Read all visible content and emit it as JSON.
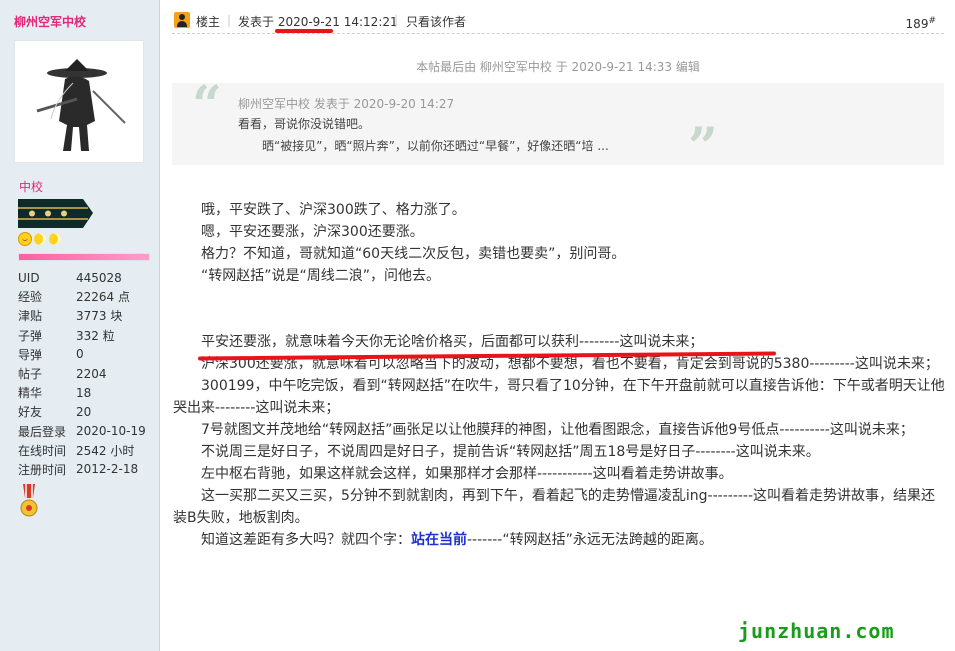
{
  "sidebar": {
    "username": "柳州空军中校",
    "rank": "中校",
    "progress": 1.0,
    "stats": [
      {
        "label": "UID",
        "value": "445028"
      },
      {
        "label": "经验",
        "value": "22264 点"
      },
      {
        "label": "津贴",
        "value": "3773 块"
      },
      {
        "label": "子弹",
        "value": "332 粒"
      },
      {
        "label": "导弹",
        "value": "0"
      },
      {
        "label": "帖子",
        "value": "2204"
      },
      {
        "label": "精华",
        "value": "18"
      },
      {
        "label": "好友",
        "value": "20"
      },
      {
        "label": "最后登录",
        "value": "2020-10-19"
      },
      {
        "label": "在线时间",
        "value": "2542 小时"
      },
      {
        "label": "注册时间",
        "value": "2012-2-18"
      }
    ]
  },
  "post": {
    "owner_label": "楼主",
    "time": "发表于 2020-9-21 14:12:21",
    "only_author": "只看该作者",
    "floor": "189",
    "floor_suffix": "#",
    "edit_note": "本帖最后由 柳州空军中校 于 2020-9-21 14:33 编辑",
    "quote": {
      "author": "柳州空军中校 发表于 2020-9-20 14:27",
      "line1": "看看，哥说你没说错吧。",
      "line2": "晒“被接见”，晒“照片奔”，以前你还晒过“早餐”，好像还晒“培 ..."
    },
    "paragraphs_top": [
      "哦，平安跌了、沪深300跌了、格力涨了。",
      "嗯，平安还要涨，沪深300还要涨。",
      "格力？不知道，哥就知道“60天线二次反包，卖错也要卖”，别问哥。",
      "“转网赵括”说是“周线二浪”，问他去。"
    ],
    "paragraphs_bottom": [
      "平安还要涨，就意味着今天你无论啥价格买，后面都可以获利--------这叫说未来；",
      "沪深300还要涨，就意味着可以忽略当下的波动，想都不要想，看也不要看，肯定会到哥说的5380---------这叫说未来；",
      "300199，中午吃完饭，看到“转网赵括”在吹牛，哥只看了10分钟，在下午开盘前就可以直接告诉他：下午或者明天让他哭出来--------这叫说未来；",
      "7号就图文并茂地给“转网赵括”画张足以让他膜拜的神图，让他看图跟念，直接告诉他9号低点----------这叫说未来；",
      "不说周三是好日子，不说周四是好日子，提前告诉“转网赵括”周五18号是好日子--------这叫说未来。",
      "左中枢右背驰，如果这样就会这样，如果那样才会那样-----------这叫看着走势讲故事。",
      "这一买那二买又三买，5分钟不到就割肉，再到下午，看着起飞的走势懵逼凌乱ing---------这叫看着走势讲故事，结果还装B失败，地板割肉。"
    ],
    "last_line": {
      "before": "知道这差距有多大吗？就四个字：",
      "highlight": "站在当前",
      "after": "-------“转网赵括”永远无法跨越的距离。"
    }
  },
  "watermark": "junzhuan.com",
  "colors": {
    "accent": "#e0297a",
    "underline": "#e8141a",
    "highlight": "#1e2fd8",
    "watermark": "#1a9b1a"
  }
}
